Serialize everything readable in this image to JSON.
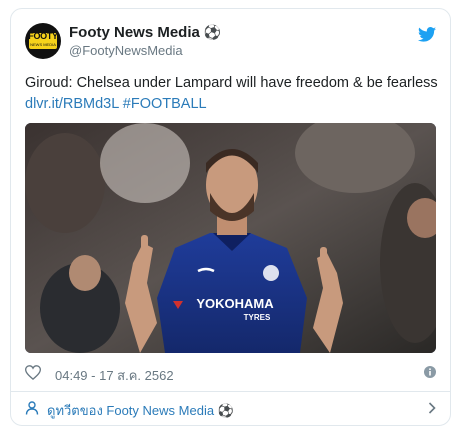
{
  "tweet": {
    "author": {
      "display_name": "Footy News Media",
      "handle": "@FootyNewsMedia",
      "emoji": "⚽",
      "avatar_label": "FOOTY",
      "avatar_sub": "NEWS MEDIA"
    },
    "text": "Giroud: Chelsea under Lampard will have freedom & be fearless",
    "link": "dlvr.it/RBMd3L",
    "hashtag": "#FOOTBALL",
    "timestamp": "04:49 - 17 ส.ค. 2562",
    "image": {
      "shirt_sponsor": "YOKOHAMA",
      "shirt_sponsor_sub": "TYRES"
    }
  },
  "footer": {
    "view_more": "ดูทวีตของ Footy News Media",
    "view_more_emoji": "⚽"
  },
  "colors": {
    "link": "#2b7bb9",
    "twitter_blue": "#1da1f2",
    "muted": "#697882",
    "border": "#e1e8ed"
  },
  "icons": [
    "twitter-bird-icon",
    "heart-icon",
    "info-icon",
    "person-icon",
    "chevron-right-icon"
  ]
}
